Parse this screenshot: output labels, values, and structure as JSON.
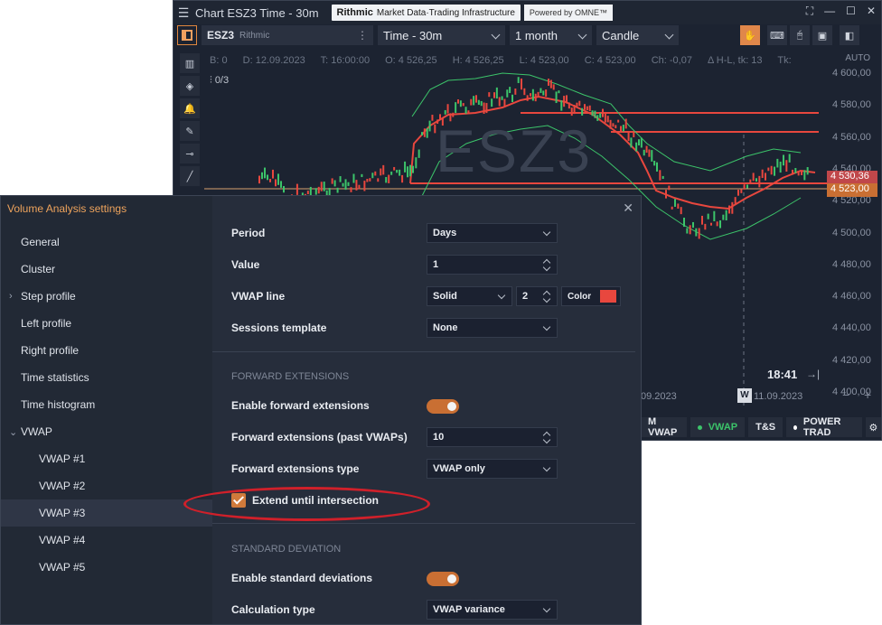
{
  "chart_window": {
    "menu_icon": "hamburger-icon",
    "title": "Chart ESZ3 Time - 30m",
    "rithmic_brand": "Rithmic",
    "rithmic_tagline": "Market Data·Trading Infrastructure",
    "omne_label": "Powered by OMNE™",
    "symbol": "ESZ3",
    "symbol_source": "Rithmic",
    "timeframe": "Time - 30m",
    "period": "1 month",
    "chart_type": "Candle",
    "ohlc": {
      "b": "B: 0",
      "d": "D: 12.09.2023",
      "t": "T: 16:00:00",
      "o": "O: 4 526,25",
      "h": "H: 4 526,25",
      "l": "L: 4 523,00",
      "c": "C: 4 523,00",
      "ch": "Ch: -0,07",
      "hl": "Δ H-L, tk: 13",
      "tk": "Tk:"
    },
    "auto_label": "AUTO",
    "indicator_count": "0/3",
    "watermark": "ESZ3",
    "price_labels": [
      "4 600,00",
      "4 580,00",
      "4 560,00",
      "4 540,00",
      "4 520,00",
      "4 500,00",
      "4 480,00",
      "4 460,00",
      "4 440,00",
      "4 420,00",
      "4 400,00"
    ],
    "price_tag_1": "4 530,36",
    "price_tag_2": "4 523,00",
    "clock": "18:41",
    "date_left": "09.2023",
    "date_badge": "W",
    "date_right": "11.09.2023",
    "bottom_buttons": [
      "M VWAP",
      "VWAP",
      "T&S",
      "POWER TRAD"
    ],
    "colors": {
      "accent": "#e0874a",
      "vwap_line": "#e8473e",
      "candle_up": "#3cc46a",
      "candle_down": "#e8473e"
    }
  },
  "dialog": {
    "title": "Volume Analysis settings",
    "nav": [
      {
        "label": "General"
      },
      {
        "label": "Cluster"
      },
      {
        "label": "Step profile"
      },
      {
        "label": "Left profile"
      },
      {
        "label": "Right profile"
      },
      {
        "label": "Time statistics"
      },
      {
        "label": "Time histogram"
      },
      {
        "label": "VWAP"
      },
      {
        "label": "VWAP #1"
      },
      {
        "label": "VWAP #2"
      },
      {
        "label": "VWAP #3"
      },
      {
        "label": "VWAP #4"
      },
      {
        "label": "VWAP #5"
      }
    ],
    "period_label": "Period",
    "period_value": "Days",
    "value_label": "Value",
    "value_value": "1",
    "vwap_line_label": "VWAP line",
    "vwap_line_style": "Solid",
    "vwap_line_width": "2",
    "color_label": "Color",
    "sessions_label": "Sessions template",
    "sessions_value": "None",
    "forward_section": "FORWARD EXTENSIONS",
    "enable_forward_label": "Enable forward extensions",
    "forward_past_label": "Forward extensions (past VWAPs)",
    "forward_past_value": "10",
    "forward_type_label": "Forward extensions type",
    "forward_type_value": "VWAP only",
    "extend_label": "Extend until intersection",
    "stddev_section": "STANDARD DEVIATION",
    "enable_stddev_label": "Enable standard deviations",
    "calc_type_label": "Calculation type",
    "calc_type_value": "VWAP variance"
  }
}
